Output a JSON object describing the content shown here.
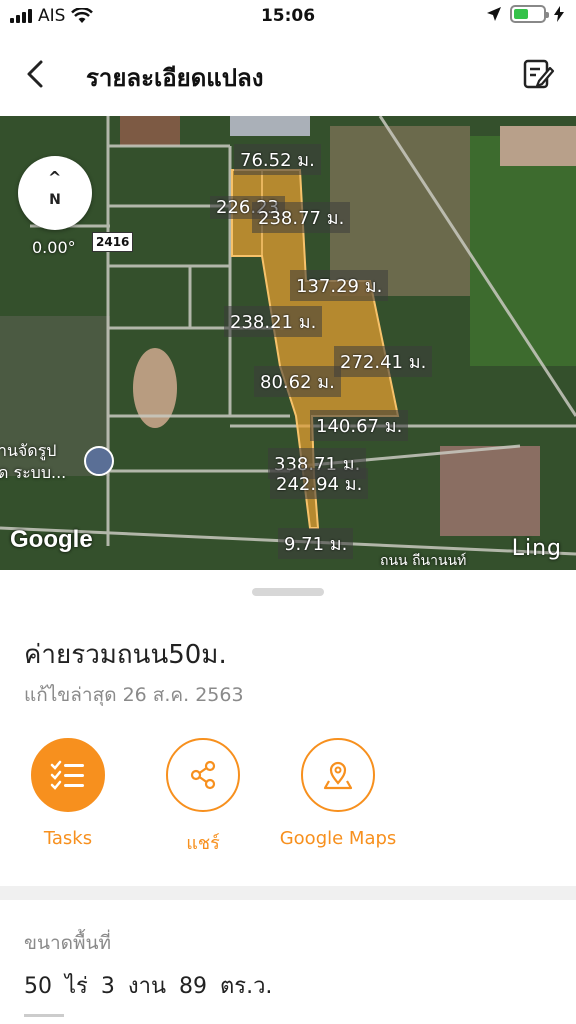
{
  "status_bar": {
    "carrier": "AIS",
    "time": "15:06",
    "battery_level": 0.5,
    "battery_color": "#35c24a"
  },
  "header": {
    "title": "รายละเอียดแปลง",
    "back_icon": "chevron-left-icon",
    "edit_icon": "edit-note-icon"
  },
  "map": {
    "compass_letter": "N",
    "heading": "0.00°",
    "route_number": "2416",
    "poi_text": "านจัดรูป\nด ระบบ...",
    "google_logo": "Google",
    "road_name": "ถนน ถีนานนท์",
    "watermark": "Ling",
    "measurements": [
      "76.52 ม.",
      "226.23",
      "238.77 ม.",
      "137.29 ม.",
      "238.21 ม.",
      "272.41 ม.",
      "80.62 ม.",
      "140.67 ม.",
      "338.71 ม.",
      "242.94 ม.",
      "9.71 ม."
    ]
  },
  "plot": {
    "name": "ค่ายรวมถนน50ม.",
    "last_edited": "แก้ไขล่าสุด 26 ส.ค. 2563"
  },
  "actions": [
    {
      "label": "Tasks",
      "icon": "checklist-icon"
    },
    {
      "label": "แชร์",
      "icon": "share-icon"
    },
    {
      "label": "Google Maps",
      "icon": "map-pin-icon"
    }
  ],
  "area": {
    "label": "ขนาดพื้นที่",
    "value": "50 ไร่  3 งาน  89 ตร.ว."
  },
  "colors": {
    "accent": "#f7901e",
    "plot_fill": "#e8a030"
  }
}
